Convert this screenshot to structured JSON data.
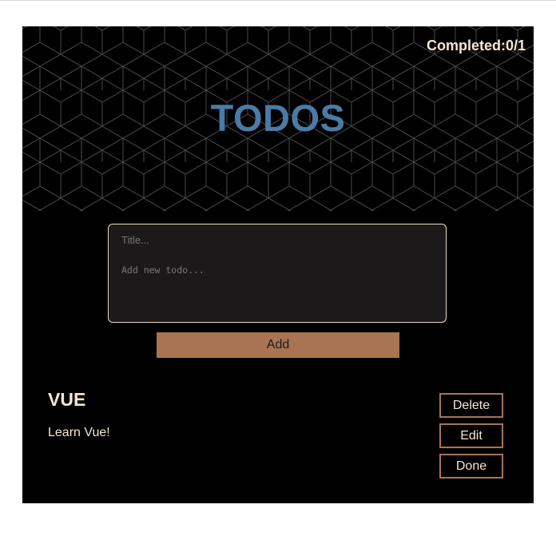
{
  "header": {
    "completed_label": "Completed:",
    "completed_count": "0/1",
    "title": "TODOS"
  },
  "form": {
    "title_placeholder": "Title...",
    "body_placeholder": "Add new todo...",
    "add_label": "Add"
  },
  "todos": [
    {
      "title": "VUE",
      "description": "Learn Vue!",
      "delete_label": "Delete",
      "edit_label": "Edit",
      "done_label": "Done"
    }
  ],
  "colors": {
    "accent": "#a97451",
    "title": "#4a7ba6",
    "text": "#f5e6d3",
    "background": "#000000"
  }
}
